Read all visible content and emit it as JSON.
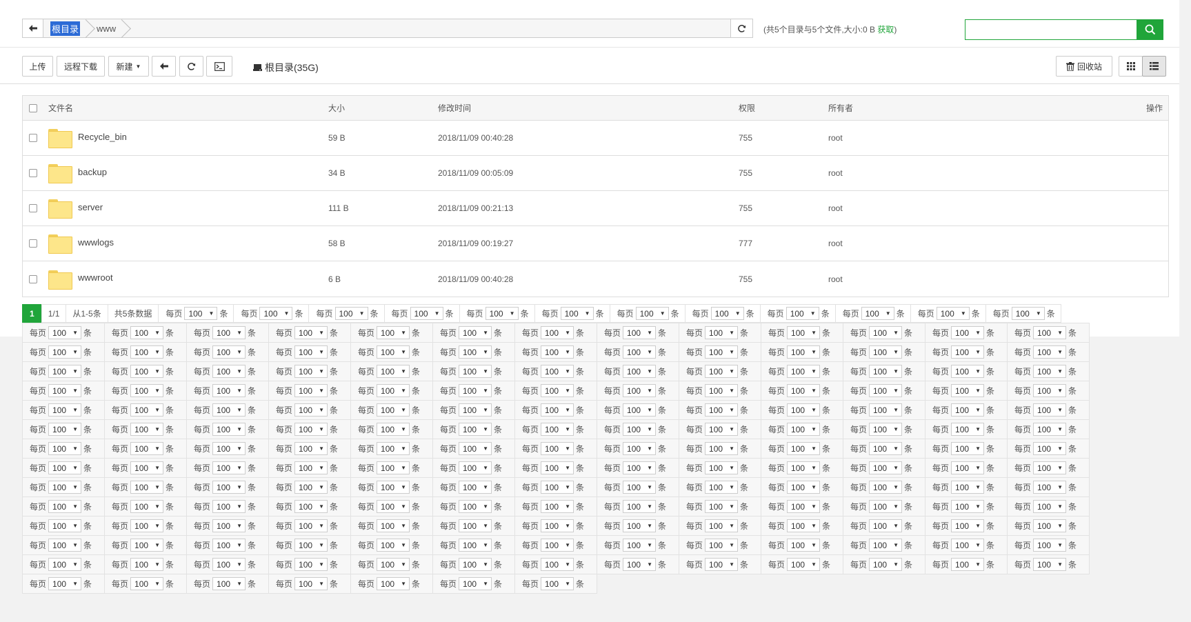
{
  "breadcrumb": {
    "root": "根目录",
    "current": "www"
  },
  "summary": {
    "text": "(共5个目录与5个文件,大小:0 B ",
    "get_link": "获取",
    "close": ")"
  },
  "search": {
    "placeholder": ""
  },
  "toolbar": {
    "upload": "上传",
    "remote_download": "远程下载",
    "new": "新建",
    "disk_label": "根目录(35G)",
    "recycle": "回收站"
  },
  "table": {
    "headers": {
      "name": "文件名",
      "size": "大小",
      "mtime": "修改时间",
      "perm": "权限",
      "owner": "所有者",
      "op": "操作"
    },
    "rows": [
      {
        "name": "Recycle_bin",
        "size": "59 B",
        "mtime": "2018/11/09 00:40:28",
        "perm": "755",
        "owner": "root"
      },
      {
        "name": "backup",
        "size": "34 B",
        "mtime": "2018/11/09 00:05:09",
        "perm": "755",
        "owner": "root"
      },
      {
        "name": "server",
        "size": "111 B",
        "mtime": "2018/11/09 00:21:13",
        "perm": "755",
        "owner": "root"
      },
      {
        "name": "wwwlogs",
        "size": "58 B",
        "mtime": "2018/11/09 00:19:27",
        "perm": "777",
        "owner": "root"
      },
      {
        "name": "wwwroot",
        "size": "6 B",
        "mtime": "2018/11/09 00:40:28",
        "perm": "755",
        "owner": "root"
      }
    ]
  },
  "pager": {
    "current": "1",
    "pages": "1/1",
    "range": "从1-5条",
    "total": "共5条数据",
    "per_page_prefix": "每页",
    "per_page_value": "100",
    "per_page_suffix": "条",
    "first_row_repeats": 12,
    "grid_rows": 14,
    "grid_cols": 13,
    "last_row_count": 7
  }
}
